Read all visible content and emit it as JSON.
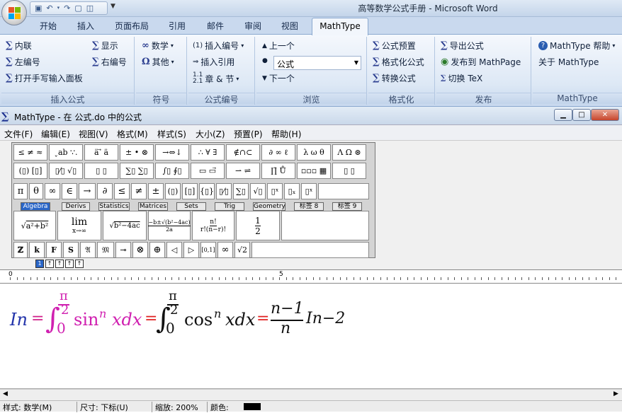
{
  "word": {
    "title": "高等数学公式手册 - Microsoft Word",
    "tabs": [
      "开始",
      "插入",
      "页面布局",
      "引用",
      "邮件",
      "审阅",
      "视图"
    ],
    "active_tab": "MathType"
  },
  "ribbon": {
    "groups": {
      "insert_eq": {
        "label": "插入公式",
        "items": [
          "内联",
          "显示",
          "左编号",
          "右编号",
          "打开手写输入面板"
        ]
      },
      "symbols": {
        "label": "符号",
        "items": [
          "数学",
          "其他"
        ]
      },
      "numbering": {
        "label": "公式编号",
        "items": [
          "插入编号",
          "插入引用",
          "章 & 节"
        ]
      },
      "browse": {
        "label": "浏览",
        "prev": "上一个",
        "combo": "公式",
        "next": "下一个"
      },
      "format": {
        "label": "格式化",
        "items": [
          "公式预置",
          "格式化公式",
          "转换公式"
        ]
      },
      "publish": {
        "label": "发布",
        "items": [
          "导出公式",
          "发布到 MathPage",
          "切换 TeX"
        ]
      },
      "mathtype": {
        "label": "MathType",
        "items": [
          "MathType 帮助",
          "关于 MathType"
        ]
      }
    }
  },
  "mathtype_window": {
    "title": "MathType - 在 公式.do 中的公式",
    "menu": [
      "文件(F)",
      "编辑(E)",
      "视图(V)",
      "格式(M)",
      "样式(S)",
      "大小(Z)",
      "预置(P)",
      "帮助(H)"
    ],
    "palette_tabs": [
      "Algebra",
      "Derivs",
      "Statistics",
      "Matrices",
      "Sets",
      "Trig",
      "Geometry",
      "标签 8",
      "标签 9"
    ],
    "active_palette_tab": "Algebra",
    "ruler_numbers": [
      "0",
      "5"
    ]
  },
  "equation": {
    "lhs": "In",
    "eq": "=",
    "int1_upper_num": "π",
    "int1_upper_den": "2",
    "int1_lower": "0",
    "int1_body": "sin",
    "int1_exp": "n",
    "int1_var": "xdx",
    "int2_upper_num": "π",
    "int2_upper_den": "2",
    "int2_lower": "0",
    "int2_body": "cos",
    "int2_exp": "n",
    "int2_var": "xdx",
    "frac_num": "n−1",
    "frac_den": "n",
    "tail": "In−2",
    "colors": {
      "lhs": "#2233aa",
      "eq": "#d0208a",
      "sin_term": "#d020b0",
      "black": "#111111",
      "red_eq": "#e02020"
    }
  },
  "status": {
    "style": "样式: 数学(M)",
    "size": "尺寸: 下标(U)",
    "zoom": "缩放: 200%",
    "color_label": "颜色:",
    "color_value": "#000000"
  }
}
